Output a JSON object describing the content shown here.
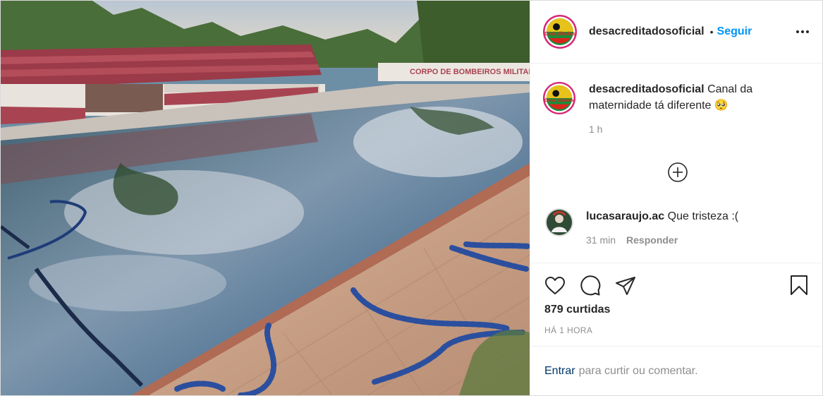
{
  "post": {
    "author": {
      "username": "desacreditadosoficial",
      "avatar_icon": "desacreditados-logo-icon",
      "avatar_text": "Desa ditados"
    },
    "follow_label": "Seguir",
    "separator": "•",
    "more_icon": "more-options-icon",
    "caption": {
      "username": "desacreditadosoficial",
      "text": "Canal da maternidade tá diferente 🥺",
      "time": "1 h"
    },
    "load_more_icon": "plus-circle-icon",
    "comments": [
      {
        "username": "lucasaraujo.ac",
        "text": "Que tristeza :(",
        "time": "31 min",
        "reply_label": "Responder"
      }
    ],
    "actions": {
      "like_icon": "heart-icon",
      "comment_icon": "comment-icon",
      "share_icon": "share-icon",
      "save_icon": "bookmark-icon"
    },
    "likes_text": "879 curtidas",
    "posted_time": "HÁ 1 HORA",
    "login": {
      "link_label": "Entrar",
      "rest_text": "para curtir ou comentar."
    },
    "image": {
      "sign_text": "CORPO DE BOMBEIROS MILITAR",
      "description_icon": "post-photo"
    },
    "colors": {
      "accent": "#0095f6",
      "text": "#262626",
      "muted": "#8e8e8e"
    }
  }
}
